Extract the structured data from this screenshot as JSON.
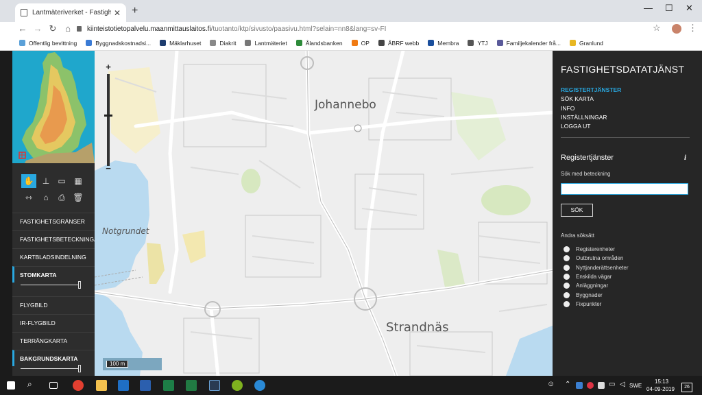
{
  "browser": {
    "tab_title": "Lantmäteriverket - Fastighetsdat",
    "new_tab_label": "+",
    "url_domain": "kiinteistotietopalvelu.maanmittauslaitos.fi",
    "url_path": "/tuotanto/ktp/sivusto/paasivu.html?selain=nn8&lang=sv-FI"
  },
  "bookmarks": [
    {
      "label": "Offentlig bevittning",
      "color": "#5aa0d8"
    },
    {
      "label": "Byggnadskostnadsi...",
      "color": "#3a7bd5"
    },
    {
      "label": "Mäklarhuset",
      "color": "#1d3c6e"
    },
    {
      "label": "Diakrit",
      "color": "#888888"
    },
    {
      "label": "Lantmäteriet",
      "color": "#777777"
    },
    {
      "label": "Ålandsbanken",
      "color": "#2e8b3a"
    },
    {
      "label": "OP",
      "color": "#f07a12"
    },
    {
      "label": "ÅBRF webb",
      "color": "#444444"
    },
    {
      "label": "Membra",
      "color": "#1a4e9c"
    },
    {
      "label": "YTJ",
      "color": "#555555"
    },
    {
      "label": "Familjekalender frå...",
      "color": "#5a5a9a"
    },
    {
      "label": "Granlund",
      "color": "#e8b722"
    }
  ],
  "left_panel": {
    "layers": [
      {
        "label": "FASTIGHETSGRÄNSER",
        "on": false
      },
      {
        "label": "FASTIGHETSBETECKNINGAR",
        "on": false
      },
      {
        "label": "KARTBLADSINDELNING",
        "on": false
      },
      {
        "label": "STOMKARTA",
        "on": true
      },
      {
        "label": "FLYGBILD",
        "on": false
      },
      {
        "label": "IR-FLYGBILD",
        "on": false
      },
      {
        "label": "TERRÄNGKARTA",
        "on": false
      },
      {
        "label": "BAKGRUNDSKARTA",
        "on": true
      }
    ],
    "stomkarta_opacity": 1.0,
    "bakgrund_opacity": 1.0
  },
  "map": {
    "places": [
      "Johannebo",
      "Notgrundet",
      "Strandnäs"
    ],
    "scale_label": "100 m",
    "zoom_in": "+",
    "zoom_out": "−",
    "zoom_level_fraction": 0.55,
    "accent": "#29a8e0"
  },
  "right_panel": {
    "title": "FASTIGHETSDATATJÄNST",
    "menu": [
      "REGISTERTJÄNSTER",
      "SÖK KARTA",
      "INFO",
      "INSTÄLLNINGAR",
      "LOGGA UT"
    ],
    "menu_selected_index": 0,
    "section_title": "Registertjänster",
    "info_icon": "i",
    "search_label": "Sök med beteckning",
    "search_value": "",
    "search_button": "SÖK",
    "other_methods_label": "Andra söksätt",
    "options": [
      "Registerenheter",
      "Outbrutna områden",
      "Nyttjanderättsenheter",
      "Enskilda vägar",
      "Anläggningar",
      "Byggnader",
      "Fixpunkter"
    ]
  },
  "taskbar": {
    "language": "SWE",
    "time": "15:13",
    "date": "04-09-2019",
    "notifications": "26"
  }
}
